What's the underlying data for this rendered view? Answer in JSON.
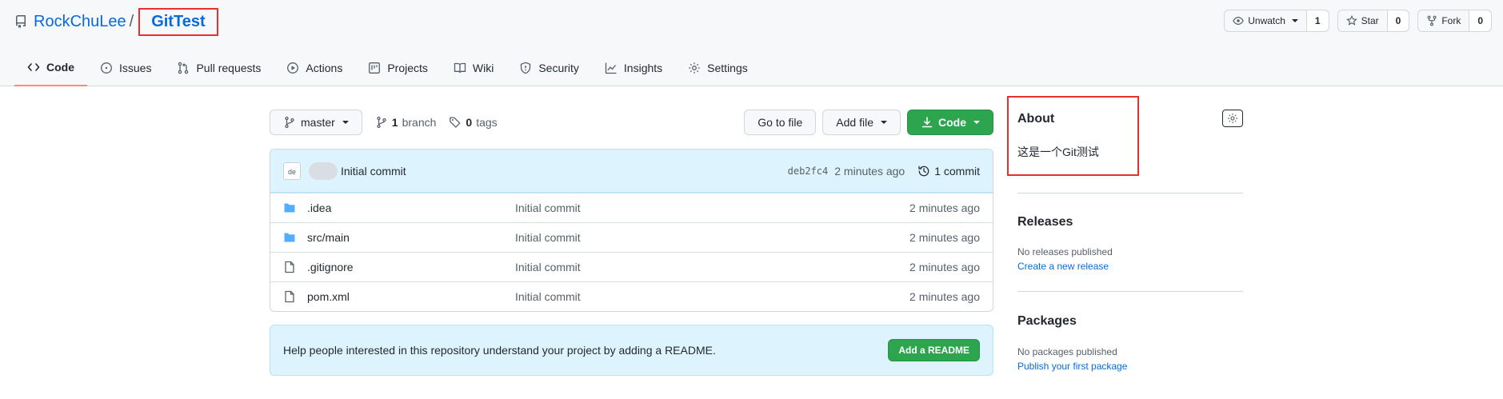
{
  "repo": {
    "owner": "RockChuLee",
    "separator": "/",
    "name": "GitTest"
  },
  "actions": {
    "watch_label": "Unwatch",
    "watch_count": "1",
    "star_label": "Star",
    "star_count": "0",
    "fork_label": "Fork",
    "fork_count": "0"
  },
  "tabs": [
    {
      "label": "Code",
      "icon": "code-icon",
      "active": true
    },
    {
      "label": "Issues",
      "icon": "issue-icon"
    },
    {
      "label": "Pull requests",
      "icon": "pull-request-icon"
    },
    {
      "label": "Actions",
      "icon": "play-icon"
    },
    {
      "label": "Projects",
      "icon": "project-icon"
    },
    {
      "label": "Wiki",
      "icon": "book-icon"
    },
    {
      "label": "Security",
      "icon": "shield-icon"
    },
    {
      "label": "Insights",
      "icon": "graph-icon"
    },
    {
      "label": "Settings",
      "icon": "gear-icon"
    }
  ],
  "toolbar": {
    "branch": "master",
    "branch_count": "1",
    "branch_word": "branch",
    "tag_count": "0",
    "tag_word": "tags",
    "go_to_file": "Go to file",
    "add_file": "Add file",
    "code": "Code"
  },
  "latest_commit": {
    "avatar_alt": "de",
    "message": "Initial commit",
    "sha": "deb2fc4",
    "time": "2 minutes ago",
    "commit_count": "1 commit"
  },
  "files": [
    {
      "type": "folder",
      "name": ".idea",
      "commit": "Initial commit",
      "age": "2 minutes ago"
    },
    {
      "type": "folder",
      "name": "src/main",
      "commit": "Initial commit",
      "age": "2 minutes ago"
    },
    {
      "type": "file",
      "name": ".gitignore",
      "commit": "Initial commit",
      "age": "2 minutes ago"
    },
    {
      "type": "file",
      "name": "pom.xml",
      "commit": "Initial commit",
      "age": "2 minutes ago"
    }
  ],
  "readme": {
    "text": "Help people interested in this repository understand your project by adding a README.",
    "button": "Add a README"
  },
  "sidebar": {
    "about_title": "About",
    "about_desc": "这是一个Git测试",
    "releases_title": "Releases",
    "releases_none": "No releases published",
    "releases_link": "Create a new release",
    "packages_title": "Packages",
    "packages_none": "No packages published",
    "packages_link": "Publish your first package"
  },
  "colors": {
    "accent": "#0969da",
    "green": "#2da44e",
    "highlight": "#e5302e",
    "tab_underline": "#fd8c73"
  }
}
